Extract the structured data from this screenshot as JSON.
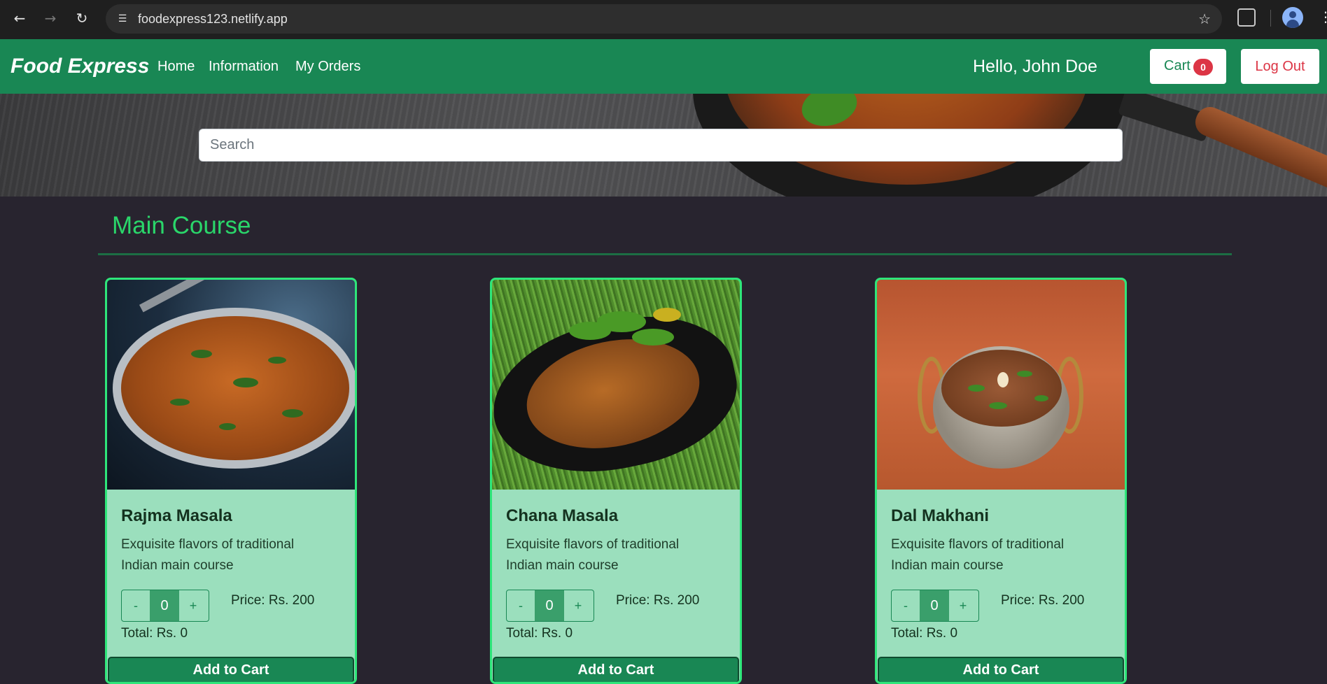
{
  "browser": {
    "url": "foodexpress123.netlify.app"
  },
  "navbar": {
    "brand": "Food Express",
    "links": [
      "Home",
      "Information",
      "My Orders"
    ],
    "greeting": "Hello, John Doe",
    "cart_label": "Cart",
    "cart_count": "0",
    "logout_label": "Log Out"
  },
  "search": {
    "placeholder": "Search",
    "value": ""
  },
  "section": {
    "title": "Main Course"
  },
  "items": [
    {
      "name": "Rajma Masala",
      "description": "Exquisite flavors of traditional Indian main course",
      "minus": "-",
      "quantity": "0",
      "plus": "+",
      "price": "Price: Rs. 200",
      "total": "Total: Rs. 0",
      "button": "Add to Cart"
    },
    {
      "name": "Chana Masala",
      "description": "Exquisite flavors of traditional Indian main course",
      "minus": "-",
      "quantity": "0",
      "plus": "+",
      "price": "Price: Rs. 200",
      "total": "Total: Rs. 0",
      "button": "Add to Cart"
    },
    {
      "name": "Dal Makhani",
      "description": "Exquisite flavors of traditional Indian main course",
      "minus": "-",
      "quantity": "0",
      "plus": "+",
      "price": "Price: Rs. 200",
      "total": "Total: Rs. 0",
      "button": "Add to Cart"
    }
  ],
  "colors": {
    "primary": "#198754",
    "danger": "#dc3545",
    "page_bg": "#28242f",
    "card_bg": "#9bdfbd",
    "card_border": "#2ee67a",
    "section_title": "#2ad66a"
  }
}
